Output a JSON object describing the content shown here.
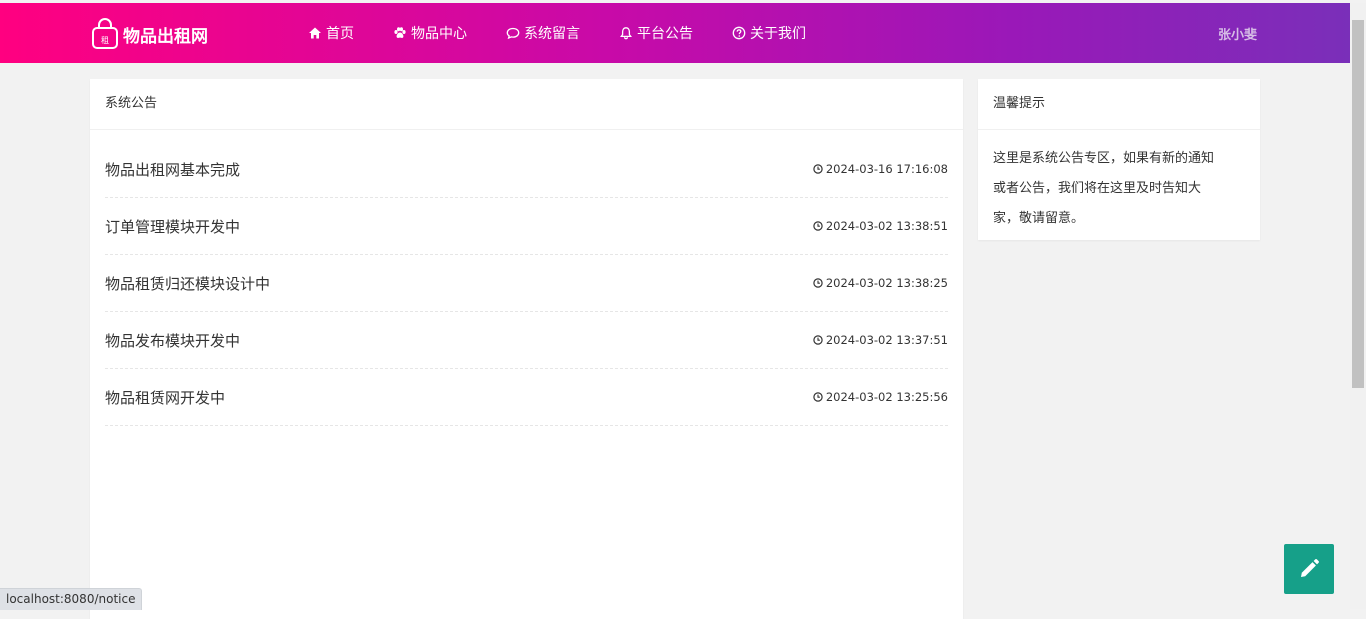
{
  "brand": {
    "name": "物品出租网",
    "icon_char": "租"
  },
  "nav": [
    {
      "label": "首页",
      "icon": "home-icon"
    },
    {
      "label": "物品中心",
      "icon": "paw-icon"
    },
    {
      "label": "系统留言",
      "icon": "comment-icon"
    },
    {
      "label": "平台公告",
      "icon": "bell-icon"
    },
    {
      "label": "关于我们",
      "icon": "question-circle-icon"
    }
  ],
  "user": {
    "name": "张小斐"
  },
  "notices": {
    "title": "系统公告",
    "items": [
      {
        "title": "物品出租网基本完成",
        "time": "2024-03-16 17:16:08"
      },
      {
        "title": "订单管理模块开发中",
        "time": "2024-03-02 13:38:51"
      },
      {
        "title": "物品租赁归还模块设计中",
        "time": "2024-03-02 13:38:25"
      },
      {
        "title": "物品发布模块开发中",
        "time": "2024-03-02 13:37:51"
      },
      {
        "title": "物品租赁网开发中",
        "time": "2024-03-02 13:25:56"
      }
    ]
  },
  "tip": {
    "title": "温馨提示",
    "lines": [
      "这里是系统公告专区，如果有新的通知",
      "或者公告，我们将在这里及时告知大",
      "家，敬请留意。"
    ]
  },
  "fab": {
    "icon": "pencil-icon"
  },
  "status_bar": {
    "url": "localhost:8080/notice"
  },
  "colors": {
    "header_start": "#ff0080",
    "header_end": "#7a2fb9",
    "fab": "#16a089",
    "page_bg": "#f2f2f2"
  }
}
